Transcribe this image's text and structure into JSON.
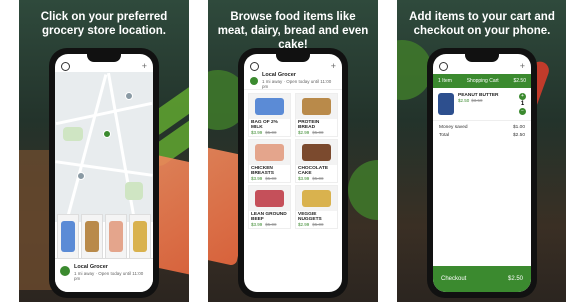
{
  "panels": [
    {
      "headline": "Click on your preferred grocery store location."
    },
    {
      "headline": "Browse food items like meat, dairy, bread and even cake!"
    },
    {
      "headline": "Add items to your cart and checkout on your phone."
    }
  ],
  "store": {
    "name": "Local Grocer",
    "subtitle": "1 mi away · Open today until 11:00 pm"
  },
  "products": [
    {
      "name": "BAG OF 2% MILK",
      "price": "$3.99",
      "old": "$5.00",
      "color": "#5b8bd6"
    },
    {
      "name": "PROTEIN BREAD",
      "price": "$2.99",
      "old": "$5.00",
      "color": "#b98a4a"
    },
    {
      "name": "CHICKEN BREASTS",
      "price": "$3.99",
      "old": "$5.00",
      "color": "#e4a58c"
    },
    {
      "name": "CHOCOLATE CAKE",
      "price": "$3.99",
      "old": "$5.00",
      "color": "#7b4a2e"
    },
    {
      "name": "LEAN GROUND BEEF",
      "price": "$3.99",
      "old": "$5.00",
      "color": "#c5505a"
    },
    {
      "name": "VEGGIE NUGGETS",
      "price": "$2.99",
      "old": "$5.00",
      "color": "#d9b24e"
    }
  ],
  "cart": {
    "count_label": "1 Item",
    "title": "Shopping Cart",
    "total_top": "$2.50",
    "item_name": "PEANUT BUTTER",
    "item_price": "$2.50",
    "item_old": "$3.50",
    "qty": "1",
    "money_saved_label": "Money saved",
    "money_saved": "$1.00",
    "total_label": "Total",
    "total": "$2.50",
    "checkout_label": "Checkout",
    "checkout_total": "$2.50"
  }
}
